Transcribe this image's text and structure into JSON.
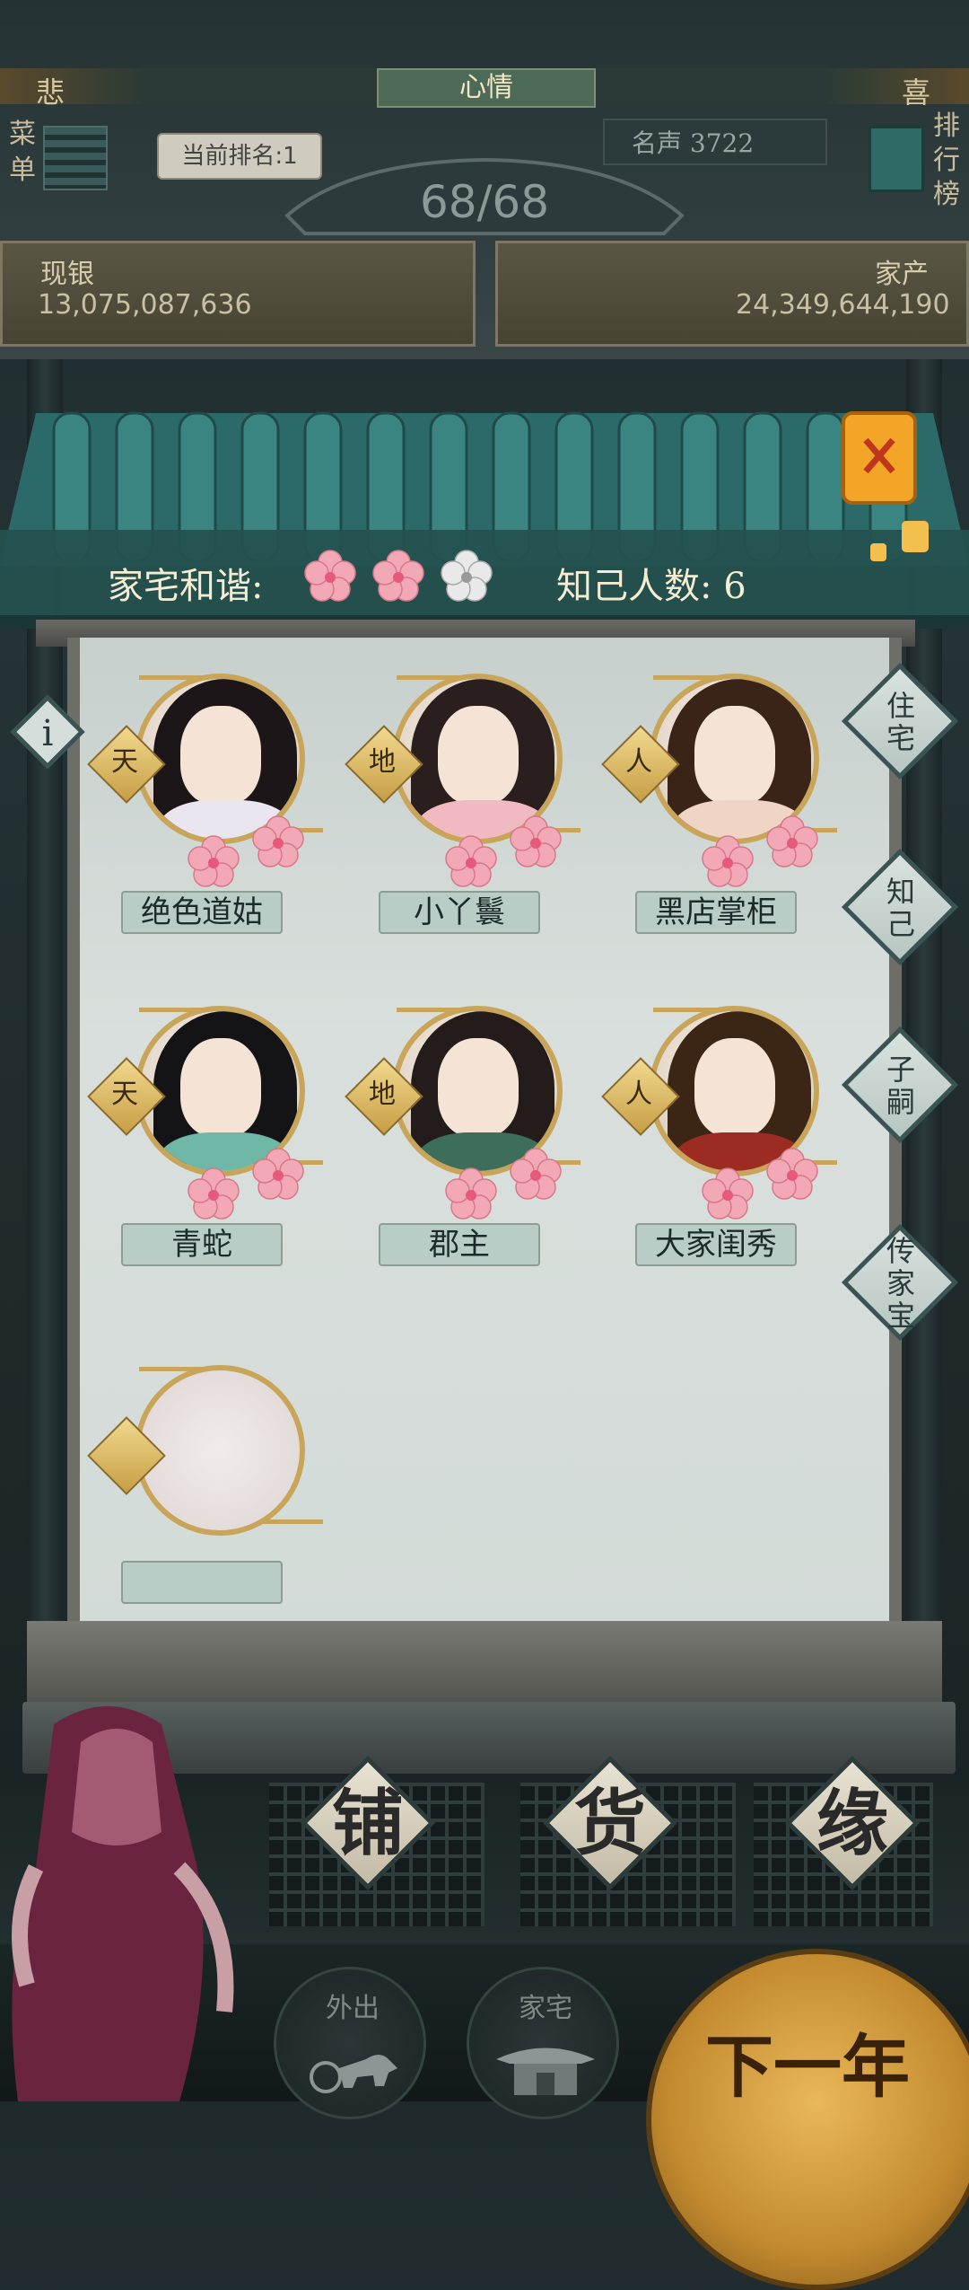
{
  "hud": {
    "mood_left": "悲",
    "mood_center": "心情",
    "mood_right": "喜",
    "menu_label": "菜单",
    "rank_label": "当前排名:1",
    "fame_label": "名声 3722",
    "leaderboard_label": "排行榜",
    "counter": "68/68",
    "silver_label": "现银",
    "silver_value": "13,075,087,636",
    "estate_label": "家产",
    "estate_value": "24,349,644,190"
  },
  "panel": {
    "harmony_label": "家宅和谐:",
    "harmony_blossoms": [
      "pink",
      "pink",
      "white"
    ],
    "know_label": "知己人数: 6",
    "characters": [
      {
        "name": "绝色道姑",
        "tier": "天",
        "robe": "#e9e6ef",
        "hair": "#1c1619"
      },
      {
        "name": "小丫鬟",
        "tier": "地",
        "robe": "#f1b9c0",
        "hair": "#2a1e1e"
      },
      {
        "name": "黑店掌柜",
        "tier": "人",
        "robe": "#f0d4c6",
        "hair": "#3a2418"
      },
      {
        "name": "青蛇",
        "tier": "天",
        "robe": "#6fb7a6",
        "hair": "#141416"
      },
      {
        "name": "郡主",
        "tier": "地",
        "robe": "#3d6e5c",
        "hair": "#241b1b"
      },
      {
        "name": "大家闺秀",
        "tier": "人",
        "robe": "#9c2b22",
        "hair": "#3b2515"
      }
    ]
  },
  "side_tabs": [
    "住宅",
    "知己",
    "子嗣",
    "传家宝"
  ],
  "shops": [
    "铺",
    "货",
    "缘"
  ],
  "nav": {
    "outing": "外出",
    "home": "家宅",
    "next_year": "下一年"
  },
  "colors": {
    "gold": "#c8a559",
    "blossom_pink": "#f3a9b5",
    "paper": "#d9dfdc",
    "teal_roof": "#2e6f6c"
  }
}
